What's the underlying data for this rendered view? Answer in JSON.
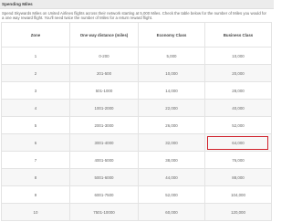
{
  "section": {
    "title": "Spending Miles",
    "intro": "Spend Skywards Miles on United Airlines flights across their network starting at 5,000 Miles. Check the table below for the number of Miles you would for a one way reward flight. You'll need twice the number of Miles for a return reward flight."
  },
  "table": {
    "headers": [
      "Zone",
      "One way distance (miles)",
      "Economy Class",
      "Business Class"
    ],
    "rows": [
      [
        "1",
        "0-200",
        "5,000",
        "10,000"
      ],
      [
        "2",
        "201-500",
        "10,000",
        "20,000"
      ],
      [
        "3",
        "501-1000",
        "14,000",
        "28,000"
      ],
      [
        "4",
        "1001-2000",
        "22,000",
        "40,000"
      ],
      [
        "5",
        "2001-3000",
        "26,000",
        "52,000"
      ],
      [
        "6",
        "3001-4000",
        "32,000",
        "64,000"
      ],
      [
        "7",
        "4001-5000",
        "38,000",
        "76,000"
      ],
      [
        "8",
        "5001-6000",
        "44,000",
        "88,000"
      ],
      [
        "9",
        "6001-7500",
        "52,000",
        "104,000"
      ],
      [
        "10",
        "7501-10000",
        "60,000",
        "120,000"
      ]
    ]
  },
  "highlight": {
    "row_zone": "6",
    "column": "Business Class",
    "color": "#d0202a"
  }
}
